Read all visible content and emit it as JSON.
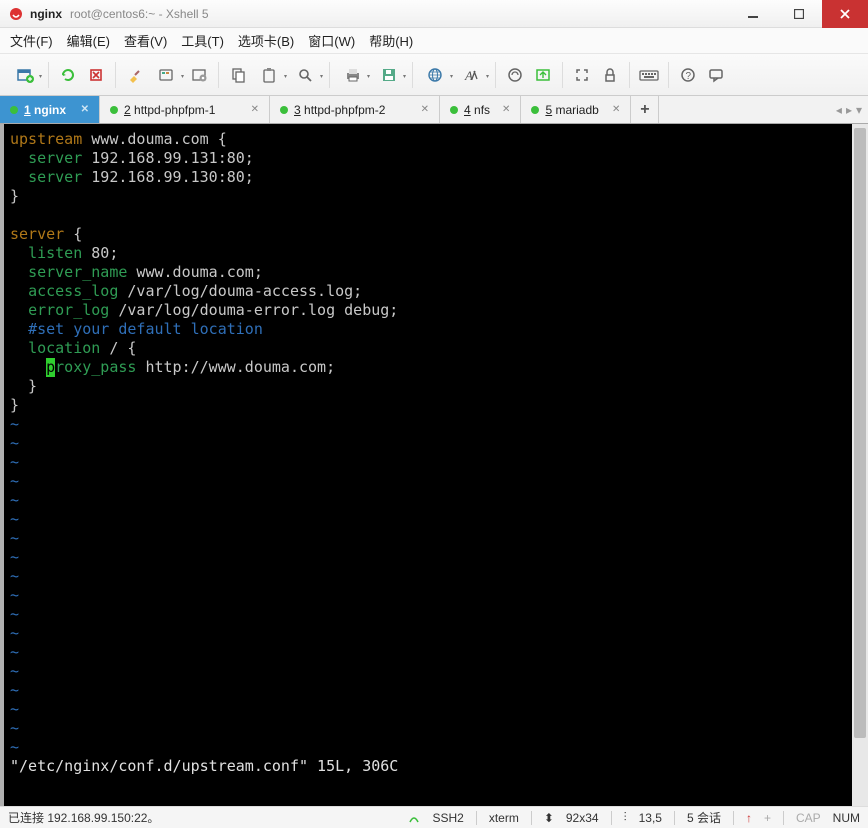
{
  "window": {
    "title_strong": "nginx",
    "title_sub": "root@centos6:~ - Xshell 5"
  },
  "menu": {
    "file": "文件(F)",
    "edit": "编辑(E)",
    "view": "查看(V)",
    "tools": "工具(T)",
    "tabs": "选项卡(B)",
    "window": "窗口(W)",
    "help": "帮助(H)"
  },
  "tabs": [
    {
      "num": "1",
      "label": "nginx",
      "active": true
    },
    {
      "num": "2",
      "label": "httpd-phpfpm-1",
      "active": false
    },
    {
      "num": "3",
      "label": "httpd-phpfpm-2",
      "active": false
    },
    {
      "num": "4",
      "label": "nfs",
      "active": false
    },
    {
      "num": "5",
      "label": "mariadb",
      "active": false
    }
  ],
  "terminal": {
    "l1_kw": "upstream",
    "l1_rest": " www.douma.com {",
    "l2_dir": "server",
    "l2_rest": " 192.168.99.131:80;",
    "l3_dir": "server",
    "l3_rest": " 192.168.99.130:80;",
    "l4": "}",
    "l6_kw": "server",
    "l6_rest": " {",
    "l7_dir": "listen",
    "l7_rest": " 80;",
    "l8_dir": "server_name",
    "l8_rest": " www.douma.com;",
    "l9_dir": "access_log",
    "l9_rest": " /var/log/douma-access.log;",
    "l10_dir": "error_log",
    "l10_rest": " /var/log/douma-error.log debug;",
    "l11_com": "#set your default location",
    "l12_dir": "location",
    "l12_rest": " / {",
    "l13_cur": "p",
    "l13_dir": "roxy_pass",
    "l13_rest": " http://www.douma.com;",
    "l14": "  }",
    "l15": "}",
    "tilde": "~",
    "fileline": "\"/etc/nginx/conf.d/upstream.conf\" 15L, 306C"
  },
  "status": {
    "conn": "已连接 192.168.99.150:22。",
    "ssh": "SSH2",
    "term": "xterm",
    "size": "92x34",
    "load": "13,5",
    "sessions": "5 会话",
    "arrow": "↑",
    "plus": "+",
    "cap": "CAP",
    "num": "NUM"
  }
}
